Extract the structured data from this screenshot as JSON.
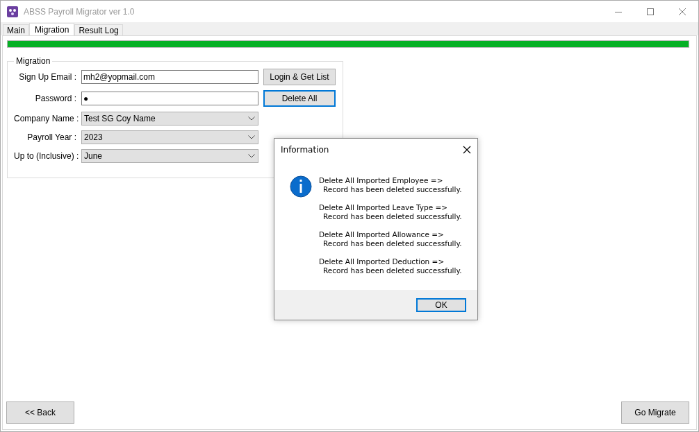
{
  "window": {
    "title": "ABSS Payroll Migrator ver 1.0"
  },
  "tabs": [
    {
      "label": "Main",
      "selected": false
    },
    {
      "label": "Migration",
      "selected": true
    },
    {
      "label": "Result Log",
      "selected": false
    }
  ],
  "progress": {
    "level": 1
  },
  "migration_group": {
    "title": "Migration",
    "fields": [
      {
        "kind": "text",
        "label": "Sign Up Email :",
        "value": "mh2@yopmail.com"
      },
      {
        "kind": "text",
        "label": "Password :",
        "value": "●"
      },
      {
        "kind": "dropdown",
        "label": "Company Name :",
        "value": "Test SG Coy Name"
      },
      {
        "kind": "dropdown",
        "label": "Payroll Year :",
        "value": "2023"
      },
      {
        "kind": "dropdown",
        "label": "Up to (Inclusive) :",
        "value": "June"
      }
    ],
    "buttons": [
      {
        "label": "Login & Get List",
        "focused": false
      },
      {
        "label": "Delete All",
        "focused": true
      }
    ]
  },
  "footer_buttons": [
    "<< Back",
    "Go Migrate"
  ],
  "dialog": {
    "title": "Information",
    "messages": [
      {
        "heading": "Delete All Imported Employee =>",
        "detail": "Record has been deleted successfully."
      },
      {
        "heading": "Delete All Imported Leave Type =>",
        "detail": "Record has been deleted successfully."
      },
      {
        "heading": "Delete All Imported Allowance =>",
        "detail": "Record has been deleted successfully."
      },
      {
        "heading": "Delete All Imported Deduction =>",
        "detail": "Record has been deleted successfully."
      }
    ],
    "ok_button": "OK"
  }
}
